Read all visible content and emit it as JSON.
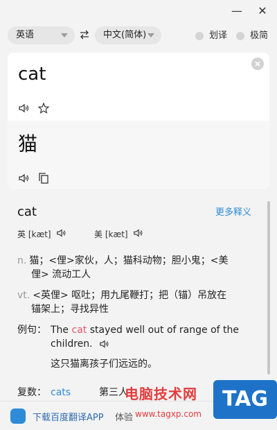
{
  "window": {
    "minimize_glyph": "—",
    "close_glyph": "✕"
  },
  "toolbar": {
    "source_lang": "英语",
    "target_lang": "中文(简体)",
    "toggle_huayi": "划译",
    "toggle_jijian": "极简"
  },
  "input": {
    "text": "cat"
  },
  "result": {
    "text": "猫"
  },
  "dictionary": {
    "word": "cat",
    "more_meanings": "更多释义",
    "uk_label": "英 [kæt]",
    "us_label": "美 [kæt]",
    "definitions": [
      {
        "pos": "n.",
        "line1": "猫；<俚>家伙，人；猫科动物；胆小鬼；<美",
        "line2": "俚> 流动工人"
      },
      {
        "pos": "vt.",
        "line1": "<英俚> 呕吐；用九尾鞭打；把（锚）吊放在",
        "line2": "锚架上；寻找异性"
      }
    ],
    "example_label": "例句：",
    "example_pre": "The ",
    "example_hl": "cat",
    "example_post": " stayed well out of range of the",
    "example_line2": "children.",
    "example_translation": "这只猫离孩子们远远的。",
    "plural_label": "复数：",
    "plural_value": "cats",
    "third_label": "第三人"
  },
  "footer": {
    "download_app": "下载百度翻译APP",
    "experience": "体验"
  },
  "watermark": {
    "site_name": "电脑技术网",
    "site_url": "www.tagxp.com",
    "tag": "TAG"
  },
  "colors": {
    "accent": "#2e8bd8",
    "highlight": "#e0556a",
    "watermark": "#e43c3c"
  }
}
